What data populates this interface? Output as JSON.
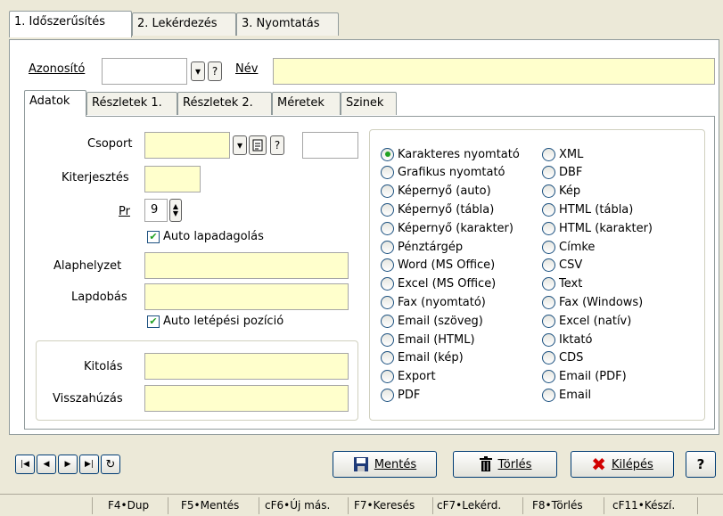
{
  "top_tabs": [
    "1. Időszerűsítés",
    "2. Lekérdezés",
    "3. Nyomtatás"
  ],
  "header": {
    "azonosito_label": "Azonosító",
    "azonosito_value": "",
    "help_label": "?",
    "nev_label": "Név",
    "nev_value": ""
  },
  "sub_tabs": [
    "Adatok",
    "Részletek 1.",
    "Részletek 2.",
    "Méretek",
    "Szinek"
  ],
  "form": {
    "csoport_label": "Csoport",
    "csoport_help": "?",
    "kiterjesztes_label": "Kiterjesztés",
    "pr_label": "Pr",
    "pr_value": "9",
    "auto_lapadagolas": "Auto lapadagolás",
    "alaphelyzet_label": "Alaphelyzet",
    "lapdobas_label": "Lapdobás",
    "auto_letepesi": "Auto letépési pozíció",
    "kitolas_label": "Kitolás",
    "visszahuzas_label": "Visszahúzás"
  },
  "radio_left": [
    "Karakteres nyomtató",
    "Grafikus nyomtató",
    "Képernyő (auto)",
    "Képernyő (tábla)",
    "Képernyő (karakter)",
    "Pénztárgép",
    "Word (MS Office)",
    "Excel (MS Office)",
    "Fax (nyomtató)",
    "Email (szöveg)",
    "Email (HTML)",
    "Email (kép)",
    "Export",
    "PDF"
  ],
  "radio_right": [
    "XML",
    "DBF",
    "Kép",
    "HTML (tábla)",
    "HTML (karakter)",
    "Címke",
    "CSV",
    "Text",
    "Fax (Windows)",
    "Excel (natív)",
    "Iktató",
    "CDS",
    "Email (PDF)",
    "Email"
  ],
  "buttons": {
    "save": "Mentés",
    "delete": "Törlés",
    "exit": "Kilépés",
    "help": "?"
  },
  "statusbar": [
    "F4•Dup",
    "F5•Mentés",
    "cF6•Új más.",
    "F7•Keresés",
    "cF7•Lekérd.",
    "F8•Törlés",
    "cF11•Készí."
  ],
  "colors": {
    "field_yellow": "#ffffcc",
    "window_bg": "#ece9d8",
    "accent_green": "#21a121",
    "exit_red": "#d10000"
  },
  "icons": [
    "first-icon",
    "prev-icon",
    "next-icon",
    "last-icon",
    "refresh-icon",
    "save-disk-icon",
    "trash-icon",
    "x-icon",
    "document-icon",
    "dropdown-arrow-icon",
    "spin-updown-icon"
  ]
}
